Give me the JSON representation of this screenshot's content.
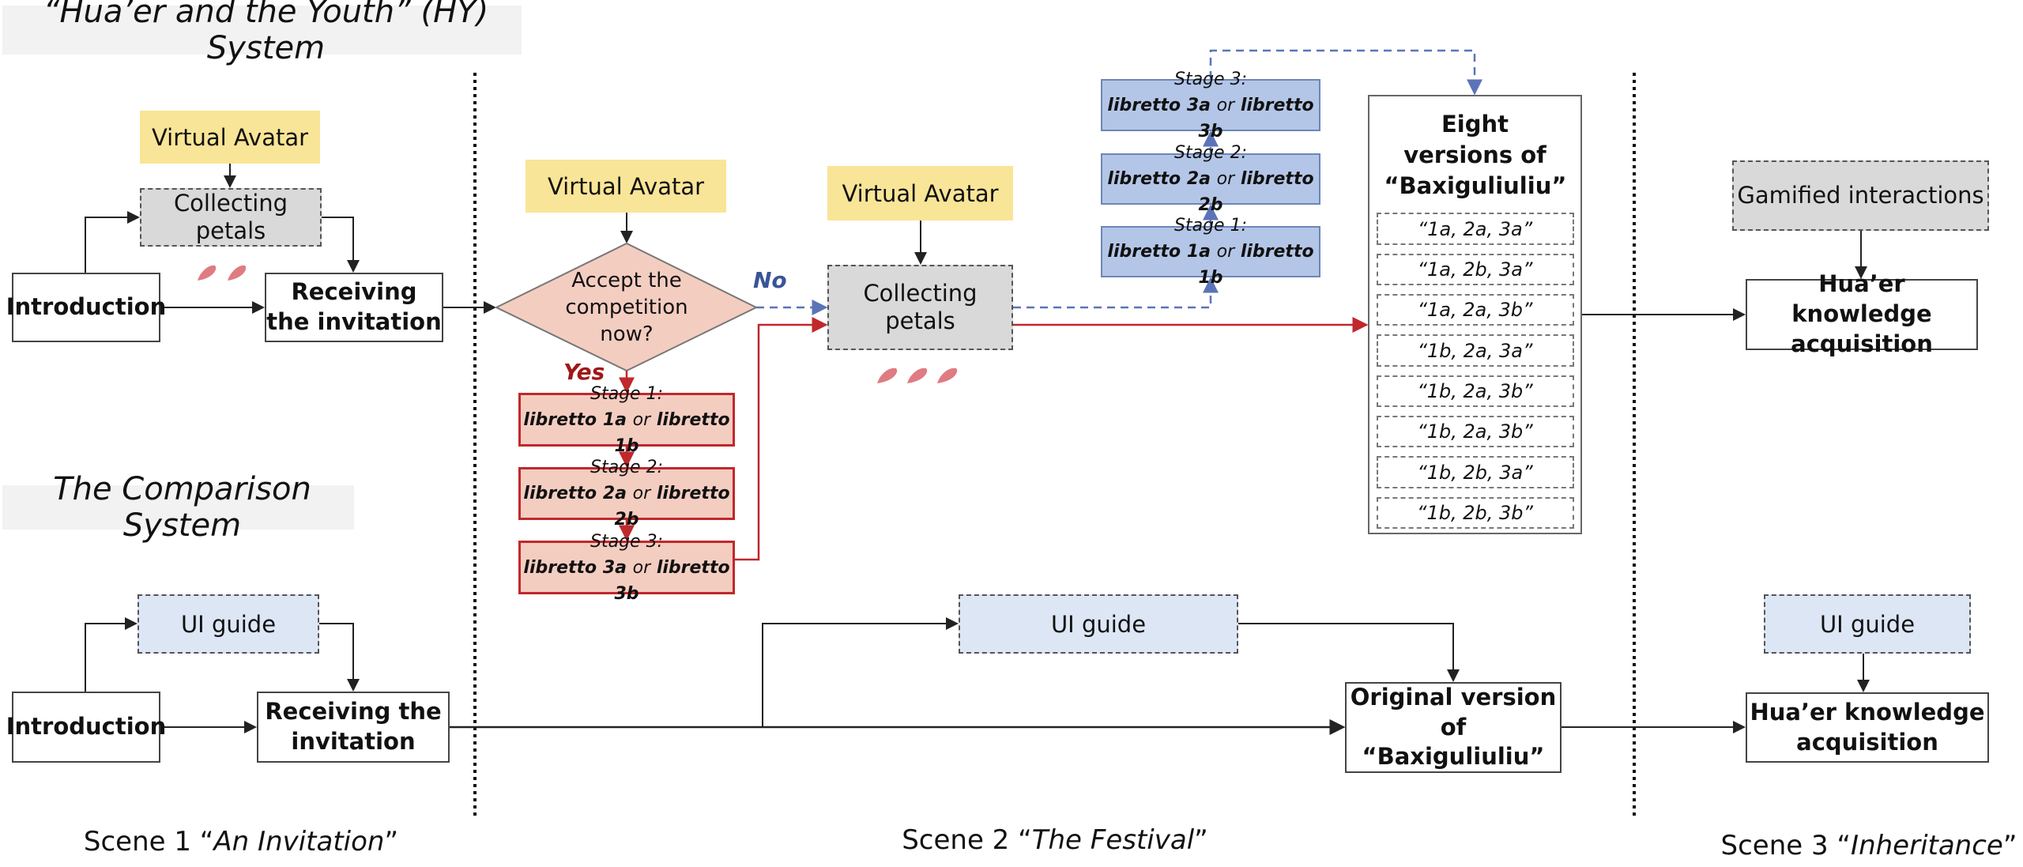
{
  "titles": {
    "hy_system": "“Hua’er and the Youth” (HY) System",
    "comparison_system": "The Comparison System"
  },
  "hy": {
    "scene1": {
      "virtual_avatar": "Virtual Avatar",
      "collecting_petals": "Collecting petals",
      "introduction": "Introduction",
      "receiving_invitation": "Receiving the invitation",
      "petal_count": 2
    },
    "scene2": {
      "virtual_avatar_decision": "Virtual Avatar",
      "decision": "Accept the competition now?",
      "yes_label": "Yes",
      "no_label": "No",
      "red_stages": [
        {
          "title": "Stage 1:",
          "left": "libretto 1a",
          "or": "or",
          "right": "libretto 1b"
        },
        {
          "title": "Stage 2:",
          "left": "libretto 2a",
          "or": "or",
          "right": "libretto 2b"
        },
        {
          "title": "Stage 3:",
          "left": "libretto 3a",
          "or": "or",
          "right": "libretto 3b"
        }
      ],
      "virtual_avatar_petals": "Virtual Avatar",
      "collecting_petals": "Collecting petals",
      "petal_count": 3,
      "blue_stages": [
        {
          "title": "Stage 3:",
          "left": "libretto 3a",
          "or": "or",
          "right": "libretto 3b"
        },
        {
          "title": "Stage 2:",
          "left": "libretto 2a",
          "or": "or",
          "right": "libretto 2b"
        },
        {
          "title": "Stage 1:",
          "left": "libretto 1a",
          "or": "or",
          "right": "libretto 1b"
        }
      ],
      "versions_title": "Eight versions of “Baxiguliuliu”",
      "versions": [
        "“1a, 2a, 3a”",
        "“1a, 2b, 3a”",
        "“1a, 2a, 3b”",
        "“1b, 2a, 3a”",
        "“1b, 2a, 3b”",
        "“1b, 2a, 3b”",
        "“1b, 2b, 3a”",
        "“1b, 2b, 3b”"
      ]
    },
    "scene3": {
      "gamified": "Gamified interactions",
      "knowledge": "Hua’er knowledge acquisition"
    }
  },
  "comparison": {
    "scene1": {
      "ui_guide": "UI guide",
      "introduction": "Introduction",
      "receiving_invitation": "Receiving the invitation"
    },
    "scene2": {
      "ui_guide": "UI guide",
      "original_version": "Original version of “Baxiguliuliu”"
    },
    "scene3": {
      "ui_guide": "UI guide",
      "knowledge": "Hua’er knowledge acquisition"
    }
  },
  "scenes": [
    {
      "prefix": "Scene 1 “",
      "name": "An Invitation",
      "suffix": "”"
    },
    {
      "prefix": "Scene 2 “",
      "name": "The Festival",
      "suffix": "”"
    },
    {
      "prefix": "Scene 3 “",
      "name": "Inheritance",
      "suffix": "”"
    }
  ],
  "colors": {
    "avatar_yellow": "#f9e597",
    "petals_gray": "#d9d9d9",
    "red_stage": "#f4cdc1",
    "red_line": "#c0282c",
    "blue_stage": "#b4c6e7",
    "blue_line": "#5b74b8",
    "ui_guide_blue": "#dde6f5",
    "petal": "#e07b82"
  }
}
